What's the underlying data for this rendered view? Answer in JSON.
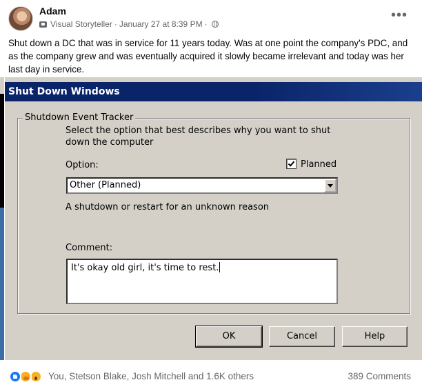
{
  "post": {
    "author": "Adam",
    "badge": "Visual Storyteller",
    "separator": "·",
    "timestamp": "January 27 at 8:39 PM",
    "separator2": "·",
    "text": "Shut down a DC that was in service for 11 years today. Was at one point the company's PDC, and as the company grew and was eventually acquired it slowly became irrelevant and today was her last day in service.",
    "more_icon": "•••"
  },
  "dialog": {
    "title": "Shut Down Windows",
    "group_label": "Shutdown Event Tracker",
    "instructions": "Select the option that best describes why you want to shut down the computer",
    "option_label": "Option:",
    "planned_label": "Planned",
    "planned_checked": true,
    "selected_option": "Other (Planned)",
    "description": "A shutdown or restart for an unknown reason",
    "comment_label": "Comment:",
    "comment_value": "It's okay old girl, it's time to rest.",
    "buttons": {
      "ok": "OK",
      "cancel": "Cancel",
      "help": "Help"
    }
  },
  "footer": {
    "reactions_text": "You, Stetson Blake, Josh Mitchell and 1.6K others",
    "comments_count": "389 Comments",
    "reaction_icons": [
      "like-icon",
      "care-icon",
      "wow-icon"
    ]
  },
  "colors": {
    "titlebar": "#0a246a",
    "dialog_face": "#d4d0c8",
    "like_blue": "#1877f2",
    "secondary_text": "#65676b"
  }
}
